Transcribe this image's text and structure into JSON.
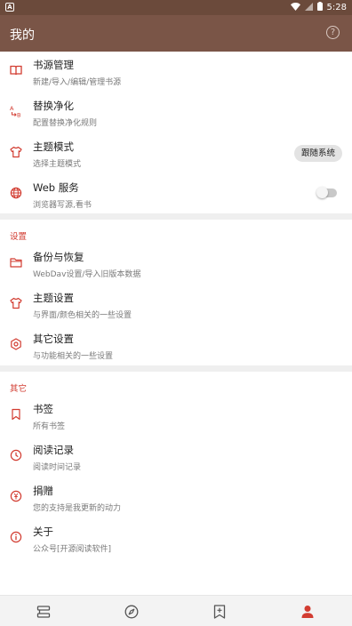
{
  "status_bar": {
    "time": "5:28",
    "app_badge": "A"
  },
  "app_bar": {
    "title": "我的",
    "help_icon": "?"
  },
  "top_items": [
    {
      "title": "书源管理",
      "subtitle": "新建/导入/编辑/管理书源",
      "icon": "book-icon"
    },
    {
      "title": "替换净化",
      "subtitle": "配置替换净化规则",
      "icon": "replace-icon"
    },
    {
      "title": "主题模式",
      "subtitle": "选择主题模式",
      "icon": "shirt-icon",
      "chip": "跟随系统"
    },
    {
      "title": "Web 服务",
      "subtitle": "浏览器写源,看书",
      "icon": "globe-icon",
      "switch_on": false
    }
  ],
  "settings_section": {
    "title": "设置",
    "items": [
      {
        "title": "备份与恢复",
        "subtitle": "WebDav设置/导入旧版本数据",
        "icon": "folder-icon"
      },
      {
        "title": "主题设置",
        "subtitle": "与界面/颜色相关的一些设置",
        "icon": "shirt-icon"
      },
      {
        "title": "其它设置",
        "subtitle": "与功能相关的一些设置",
        "icon": "settings-icon"
      }
    ]
  },
  "other_section": {
    "title": "其它",
    "items": [
      {
        "title": "书签",
        "subtitle": "所有书签",
        "icon": "bookmark-icon"
      },
      {
        "title": "阅读记录",
        "subtitle": "阅读时间记录",
        "icon": "clock-icon"
      },
      {
        "title": "捐赠",
        "subtitle": "您的支持是我更新的动力",
        "icon": "donate-icon"
      },
      {
        "title": "关于",
        "subtitle": "公众号[开源阅读软件]",
        "icon": "info-icon"
      }
    ]
  },
  "bottom_nav": [
    {
      "name": "bookshelf",
      "icon": "bookshelf-icon",
      "active": false
    },
    {
      "name": "discover",
      "icon": "compass-icon",
      "active": false
    },
    {
      "name": "rss",
      "icon": "bookmark-star-icon",
      "active": false
    },
    {
      "name": "my",
      "icon": "person-icon",
      "active": true
    }
  ],
  "colors": {
    "accent": "#d23c31",
    "appbar": "#7a5547",
    "statusbar": "#6b4a3b"
  }
}
